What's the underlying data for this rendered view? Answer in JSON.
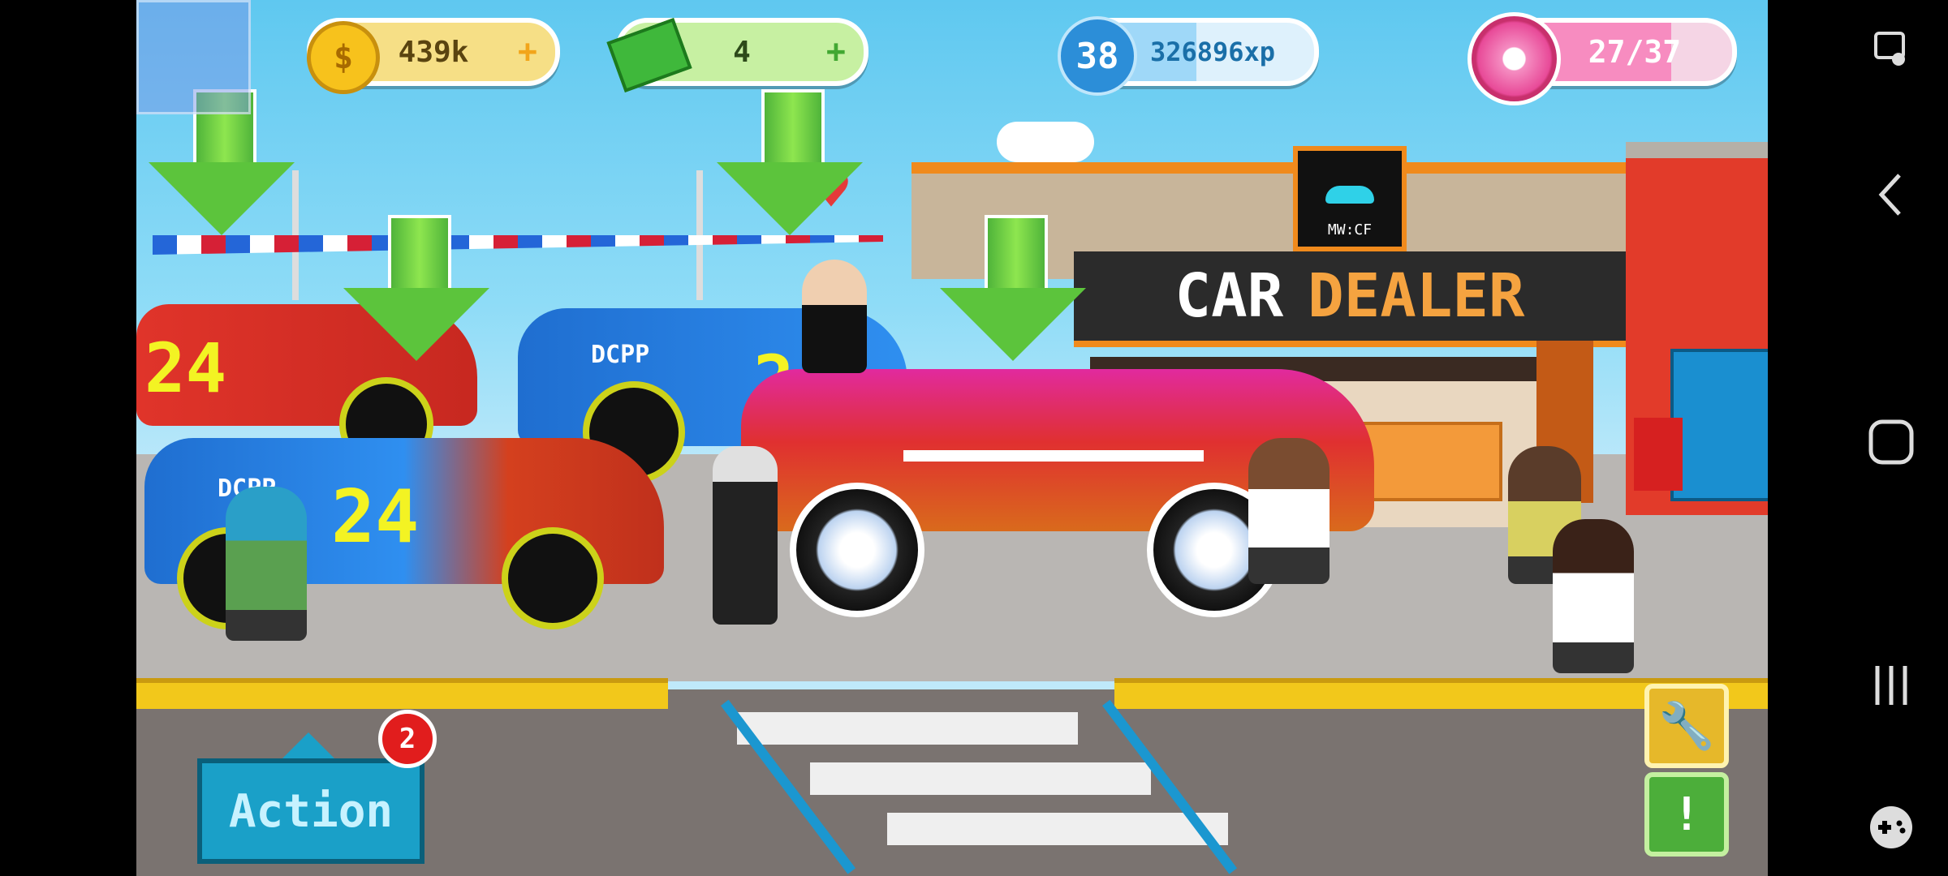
{
  "hud": {
    "coins": "439k",
    "cash": "4",
    "level": "38",
    "xp": "326896xp",
    "donuts": "27/37",
    "plus": "+"
  },
  "dealer": {
    "sign": "CAR DEALER",
    "sign_part1": "CAR",
    "sign_part2": "DEALER",
    "logo_text": "MW:CF"
  },
  "cars": {
    "number": "24",
    "brand": "DCPP"
  },
  "controls": {
    "action_label": "Action",
    "action_badge": "2",
    "alert_label": "!"
  },
  "colors": {
    "accent_gold": "#f2c81b",
    "accent_green": "#5cc43c",
    "action_blue": "#1aa0c8",
    "donut_pink": "#f05a9a"
  },
  "icons": [
    "coin-icon",
    "cash-icon",
    "xp-level-icon",
    "donut-icon",
    "wrench-icon",
    "exclamation-icon",
    "screenshot-icon",
    "back-icon",
    "home-icon",
    "recents-icon",
    "gamepad-icon"
  ]
}
